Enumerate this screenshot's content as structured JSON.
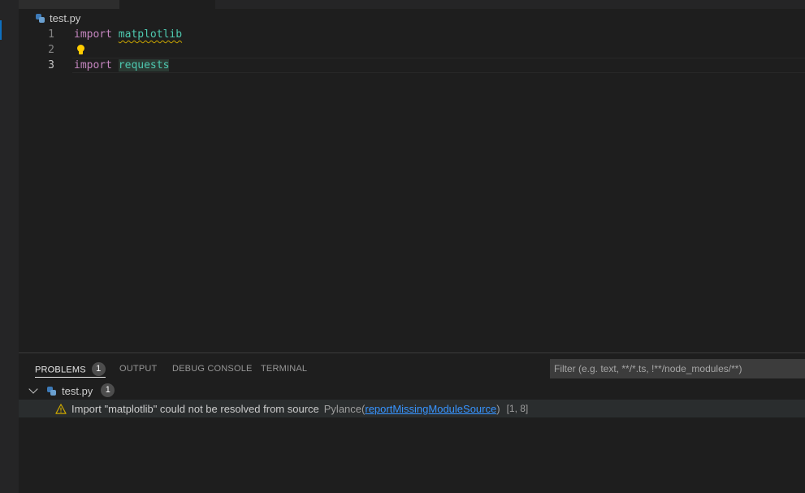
{
  "editor": {
    "breadcrumb_file": "test.py",
    "lines": [
      {
        "number": "1",
        "keyword": "import",
        "module": "matplotlib"
      },
      {
        "number": "2"
      },
      {
        "number": "3",
        "keyword": "import",
        "module": "requests"
      }
    ]
  },
  "panel": {
    "tabs": [
      {
        "label": "PROBLEMS",
        "badge": "1"
      },
      {
        "label": "OUTPUT"
      },
      {
        "label": "DEBUG CONSOLE"
      },
      {
        "label": "TERMINAL"
      }
    ],
    "filter_placeholder": "Filter (e.g. text, **/*.ts, !**/node_modules/**)",
    "problems": {
      "file": "test.py",
      "count": "1",
      "items": [
        {
          "message": "Import \"matplotlib\" could not be resolved from source",
          "source": "Pylance",
          "open_paren": "(",
          "code": "reportMissingModuleSource",
          "close_paren": ")",
          "position": "[1, 8]"
        }
      ]
    }
  },
  "colors": {
    "keyword": "#c586c0",
    "module": "#4ec9b0",
    "warning": "#cca700",
    "link": "#3794ff",
    "accent": "#0e70c0"
  },
  "icons": {
    "file": "python-file-icon",
    "warning": "warning-icon",
    "lightbulb": "lightbulb-icon",
    "expand": "chevron-down-icon"
  }
}
